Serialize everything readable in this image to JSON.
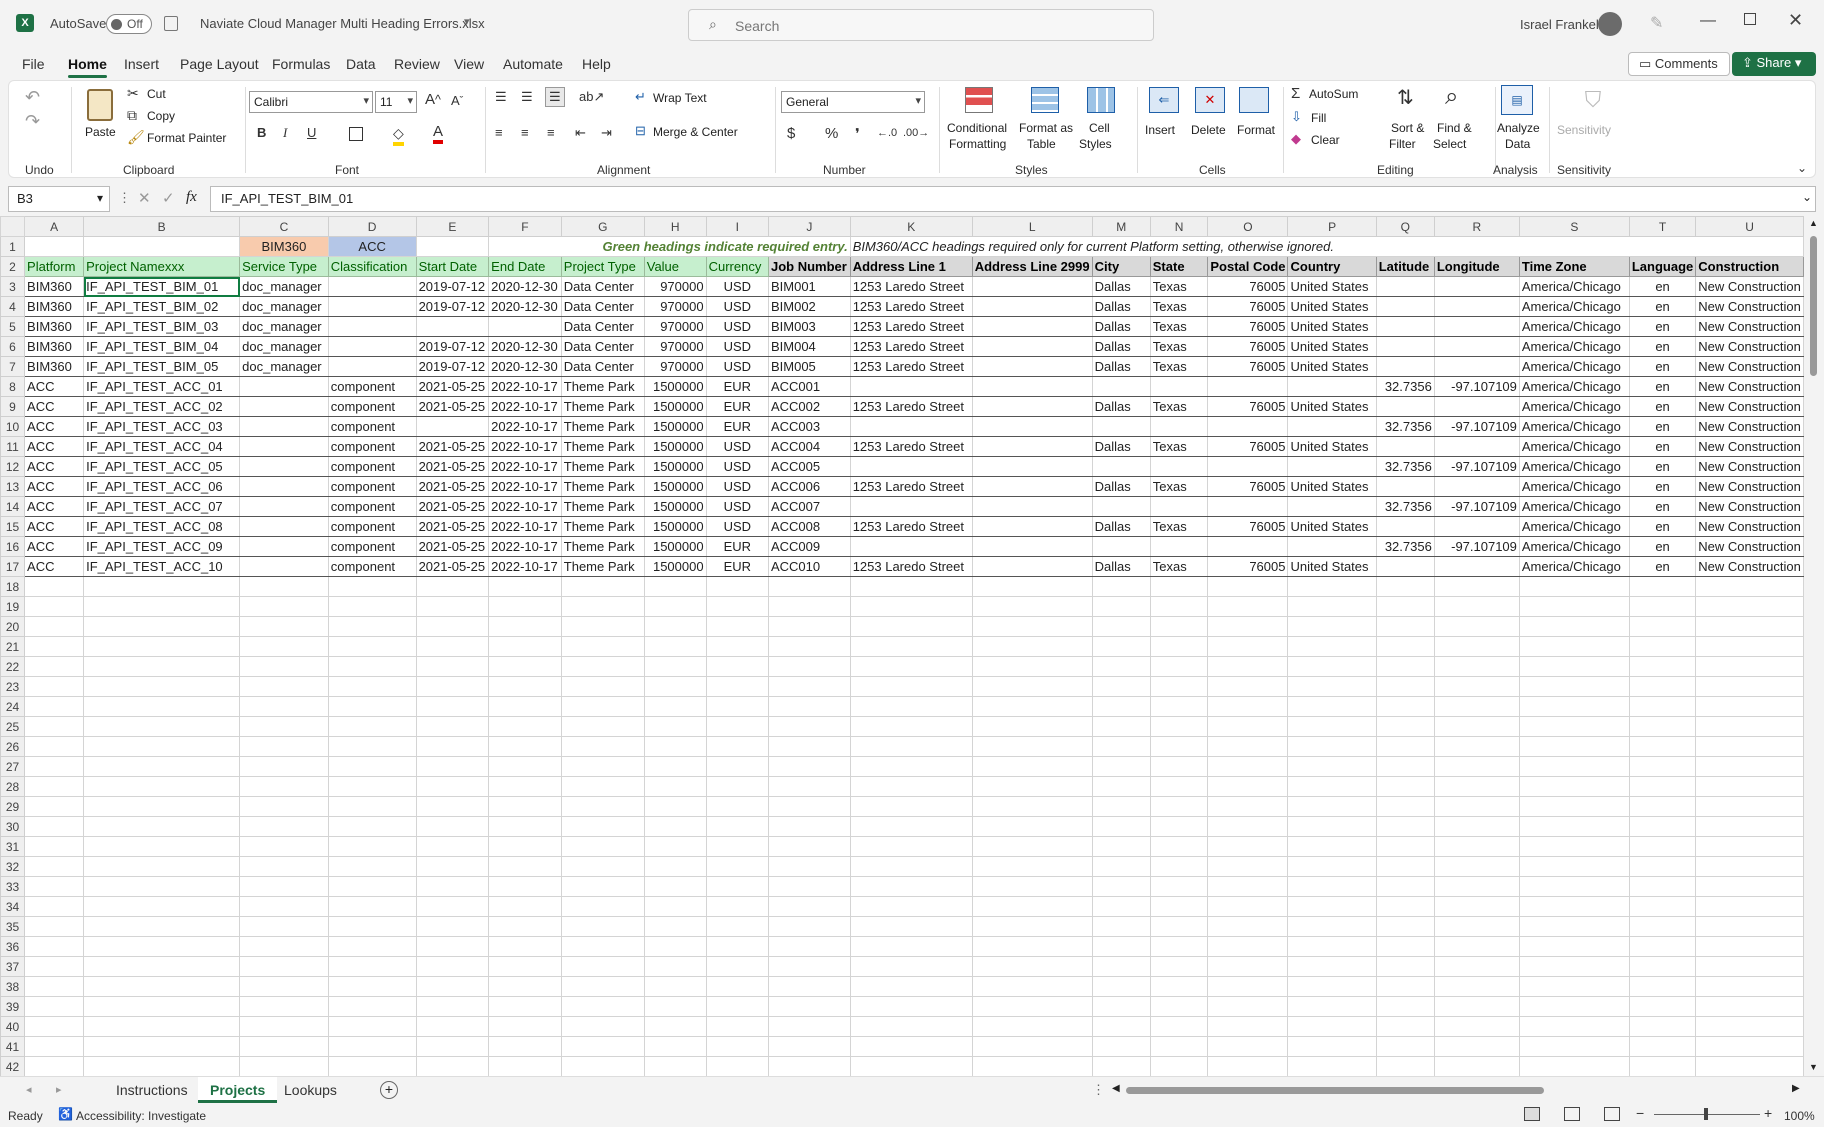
{
  "titlebar": {
    "autosave_label": "AutoSave",
    "autosave_state": "Off",
    "filename": "Naviate Cloud Manager Multi Heading Errors.xlsx",
    "search_placeholder": "Search",
    "user_name": "Israel Frankel"
  },
  "menu": {
    "items": [
      "File",
      "Home",
      "Insert",
      "Page Layout",
      "Formulas",
      "Data",
      "Review",
      "View",
      "Automate",
      "Help"
    ],
    "active": "Home",
    "comments": "Comments",
    "share": "Share"
  },
  "ribbon": {
    "groups": [
      "Undo",
      "Clipboard",
      "Font",
      "Alignment",
      "Number",
      "Styles",
      "Cells",
      "Editing",
      "Analysis",
      "Sensitivity"
    ],
    "paste": "Paste",
    "cut": "Cut",
    "copy": "Copy",
    "format_painter": "Format Painter",
    "font_name": "Calibri",
    "font_size": "11",
    "wrap_text": "Wrap Text",
    "merge_center": "Merge & Center",
    "number_format": "General",
    "conditional_formatting": [
      "Conditional",
      "Formatting"
    ],
    "format_as_table": [
      "Format as",
      "Table"
    ],
    "cell_styles": [
      "Cell",
      "Styles"
    ],
    "insert": "Insert",
    "delete": "Delete",
    "format": "Format",
    "autosum": "AutoSum",
    "fill": "Fill",
    "clear": "Clear",
    "sort_filter": [
      "Sort &",
      "Filter"
    ],
    "find_select": [
      "Find &",
      "Select"
    ],
    "analyze_data": [
      "Analyze",
      "Data"
    ],
    "sensitivity": "Sensitivity",
    "accent_color": "#1e7145"
  },
  "formula_bar": {
    "name_box": "B3",
    "formula": "IF_API_TEST_BIM_01"
  },
  "sheet": {
    "columns": [
      "A",
      "B",
      "C",
      "D",
      "E",
      "F",
      "G",
      "H",
      "I",
      "J",
      "K",
      "L",
      "M",
      "N",
      "O",
      "P",
      "Q",
      "R",
      "S",
      "T",
      "U"
    ],
    "row1": {
      "bim360": "BIM360",
      "acc": "ACC",
      "note1": "Green headings indicate required entry.",
      "note2": "BIM360/ACC headings required only for current Platform setting, otherwise ignored."
    },
    "headers": [
      "Platform",
      "Project Namexxx",
      "Service Type",
      "Classification",
      "Start Date",
      "End Date",
      "Project Type",
      "Value",
      "Currency",
      "Job Number",
      "Address Line 1",
      "Address Line 2999",
      "City",
      "State",
      "Postal Code",
      "Country",
      "Latitude",
      "Longitude",
      "Time Zone",
      "Language",
      "Construction"
    ],
    "required_cols": [
      0,
      1,
      2,
      3,
      4,
      5,
      6,
      7,
      8
    ],
    "rows": [
      [
        "BIM360",
        "IF_API_TEST_BIM_01",
        "doc_manager",
        "",
        "2019-07-12",
        "2020-12-30",
        "Data Center",
        "970000",
        "USD",
        "BIM001",
        "1253 Laredo Street",
        "",
        "Dallas",
        "Texas",
        "76005",
        "United States",
        "",
        "",
        "America/Chicago",
        "en",
        "New Construction"
      ],
      [
        "BIM360",
        "IF_API_TEST_BIM_02",
        "doc_manager",
        "",
        "2019-07-12",
        "2020-12-30",
        "Data Center",
        "970000",
        "USD",
        "BIM002",
        "1253 Laredo Street",
        "",
        "Dallas",
        "Texas",
        "76005",
        "United States",
        "",
        "",
        "America/Chicago",
        "en",
        "New Construction"
      ],
      [
        "BIM360",
        "IF_API_TEST_BIM_03",
        "doc_manager",
        "",
        "",
        "",
        "Data Center",
        "970000",
        "USD",
        "BIM003",
        "1253 Laredo Street",
        "",
        "Dallas",
        "Texas",
        "76005",
        "United States",
        "",
        "",
        "America/Chicago",
        "en",
        "New Construction"
      ],
      [
        "BIM360",
        "IF_API_TEST_BIM_04",
        "doc_manager",
        "",
        "2019-07-12",
        "2020-12-30",
        "Data Center",
        "970000",
        "USD",
        "BIM004",
        "1253 Laredo Street",
        "",
        "Dallas",
        "Texas",
        "76005",
        "United States",
        "",
        "",
        "America/Chicago",
        "en",
        "New Construction"
      ],
      [
        "BIM360",
        "IF_API_TEST_BIM_05",
        "doc_manager",
        "",
        "2019-07-12",
        "2020-12-30",
        "Data Center",
        "970000",
        "USD",
        "BIM005",
        "1253 Laredo Street",
        "",
        "Dallas",
        "Texas",
        "76005",
        "United States",
        "",
        "",
        "America/Chicago",
        "en",
        "New Construction"
      ],
      [
        "ACC",
        "IF_API_TEST_ACC_01",
        "",
        "component",
        "2021-05-25",
        "2022-10-17",
        "Theme Park",
        "1500000",
        "EUR",
        "ACC001",
        "",
        "",
        "",
        "",
        "",
        "",
        "32.7356",
        "-97.107109",
        "America/Chicago",
        "en",
        "New Construction"
      ],
      [
        "ACC",
        "IF_API_TEST_ACC_02",
        "",
        "component",
        "2021-05-25",
        "2022-10-17",
        "Theme Park",
        "1500000",
        "EUR",
        "ACC002",
        "1253 Laredo Street",
        "",
        "Dallas",
        "Texas",
        "76005",
        "United States",
        "",
        "",
        "America/Chicago",
        "en",
        "New Construction"
      ],
      [
        "ACC",
        "IF_API_TEST_ACC_03",
        "",
        "component",
        "",
        "2022-10-17",
        "Theme Park",
        "1500000",
        "EUR",
        "ACC003",
        "",
        "",
        "",
        "",
        "",
        "",
        "32.7356",
        "-97.107109",
        "America/Chicago",
        "en",
        "New Construction"
      ],
      [
        "ACC",
        "IF_API_TEST_ACC_04",
        "",
        "component",
        "2021-05-25",
        "2022-10-17",
        "Theme Park",
        "1500000",
        "USD",
        "ACC004",
        "1253 Laredo Street",
        "",
        "Dallas",
        "Texas",
        "76005",
        "United States",
        "",
        "",
        "America/Chicago",
        "en",
        "New Construction"
      ],
      [
        "ACC",
        "IF_API_TEST_ACC_05",
        "",
        "component",
        "2021-05-25",
        "2022-10-17",
        "Theme Park",
        "1500000",
        "USD",
        "ACC005",
        "",
        "",
        "",
        "",
        "",
        "",
        "32.7356",
        "-97.107109",
        "America/Chicago",
        "en",
        "New Construction"
      ],
      [
        "ACC",
        "IF_API_TEST_ACC_06",
        "",
        "component",
        "2021-05-25",
        "2022-10-17",
        "Theme Park",
        "1500000",
        "USD",
        "ACC006",
        "1253 Laredo Street",
        "",
        "Dallas",
        "Texas",
        "76005",
        "United States",
        "",
        "",
        "America/Chicago",
        "en",
        "New Construction"
      ],
      [
        "ACC",
        "IF_API_TEST_ACC_07",
        "",
        "component",
        "2021-05-25",
        "2022-10-17",
        "Theme Park",
        "1500000",
        "USD",
        "ACC007",
        "",
        "",
        "",
        "",
        "",
        "",
        "32.7356",
        "-97.107109",
        "America/Chicago",
        "en",
        "New Construction"
      ],
      [
        "ACC",
        "IF_API_TEST_ACC_08",
        "",
        "component",
        "2021-05-25",
        "2022-10-17",
        "Theme Park",
        "1500000",
        "USD",
        "ACC008",
        "1253 Laredo Street",
        "",
        "Dallas",
        "Texas",
        "76005",
        "United States",
        "",
        "",
        "America/Chicago",
        "en",
        "New Construction"
      ],
      [
        "ACC",
        "IF_API_TEST_ACC_09",
        "",
        "component",
        "2021-05-25",
        "2022-10-17",
        "Theme Park",
        "1500000",
        "EUR",
        "ACC009",
        "",
        "",
        "",
        "",
        "",
        "",
        "32.7356",
        "-97.107109",
        "America/Chicago",
        "en",
        "New Construction"
      ],
      [
        "ACC",
        "IF_API_TEST_ACC_10",
        "",
        "component",
        "2021-05-25",
        "2022-10-17",
        "Theme Park",
        "1500000",
        "EUR",
        "ACC010",
        "1253 Laredo Street",
        "",
        "Dallas",
        "Texas",
        "76005",
        "United States",
        "",
        "",
        "America/Chicago",
        "en",
        "New Construction"
      ]
    ],
    "visible_rows": 42
  },
  "tabs": {
    "items": [
      "Instructions",
      "Projects",
      "Lookups"
    ],
    "active": "Projects"
  },
  "status": {
    "ready": "Ready",
    "accessibility": "Accessibility: Investigate",
    "zoom": "100%"
  }
}
